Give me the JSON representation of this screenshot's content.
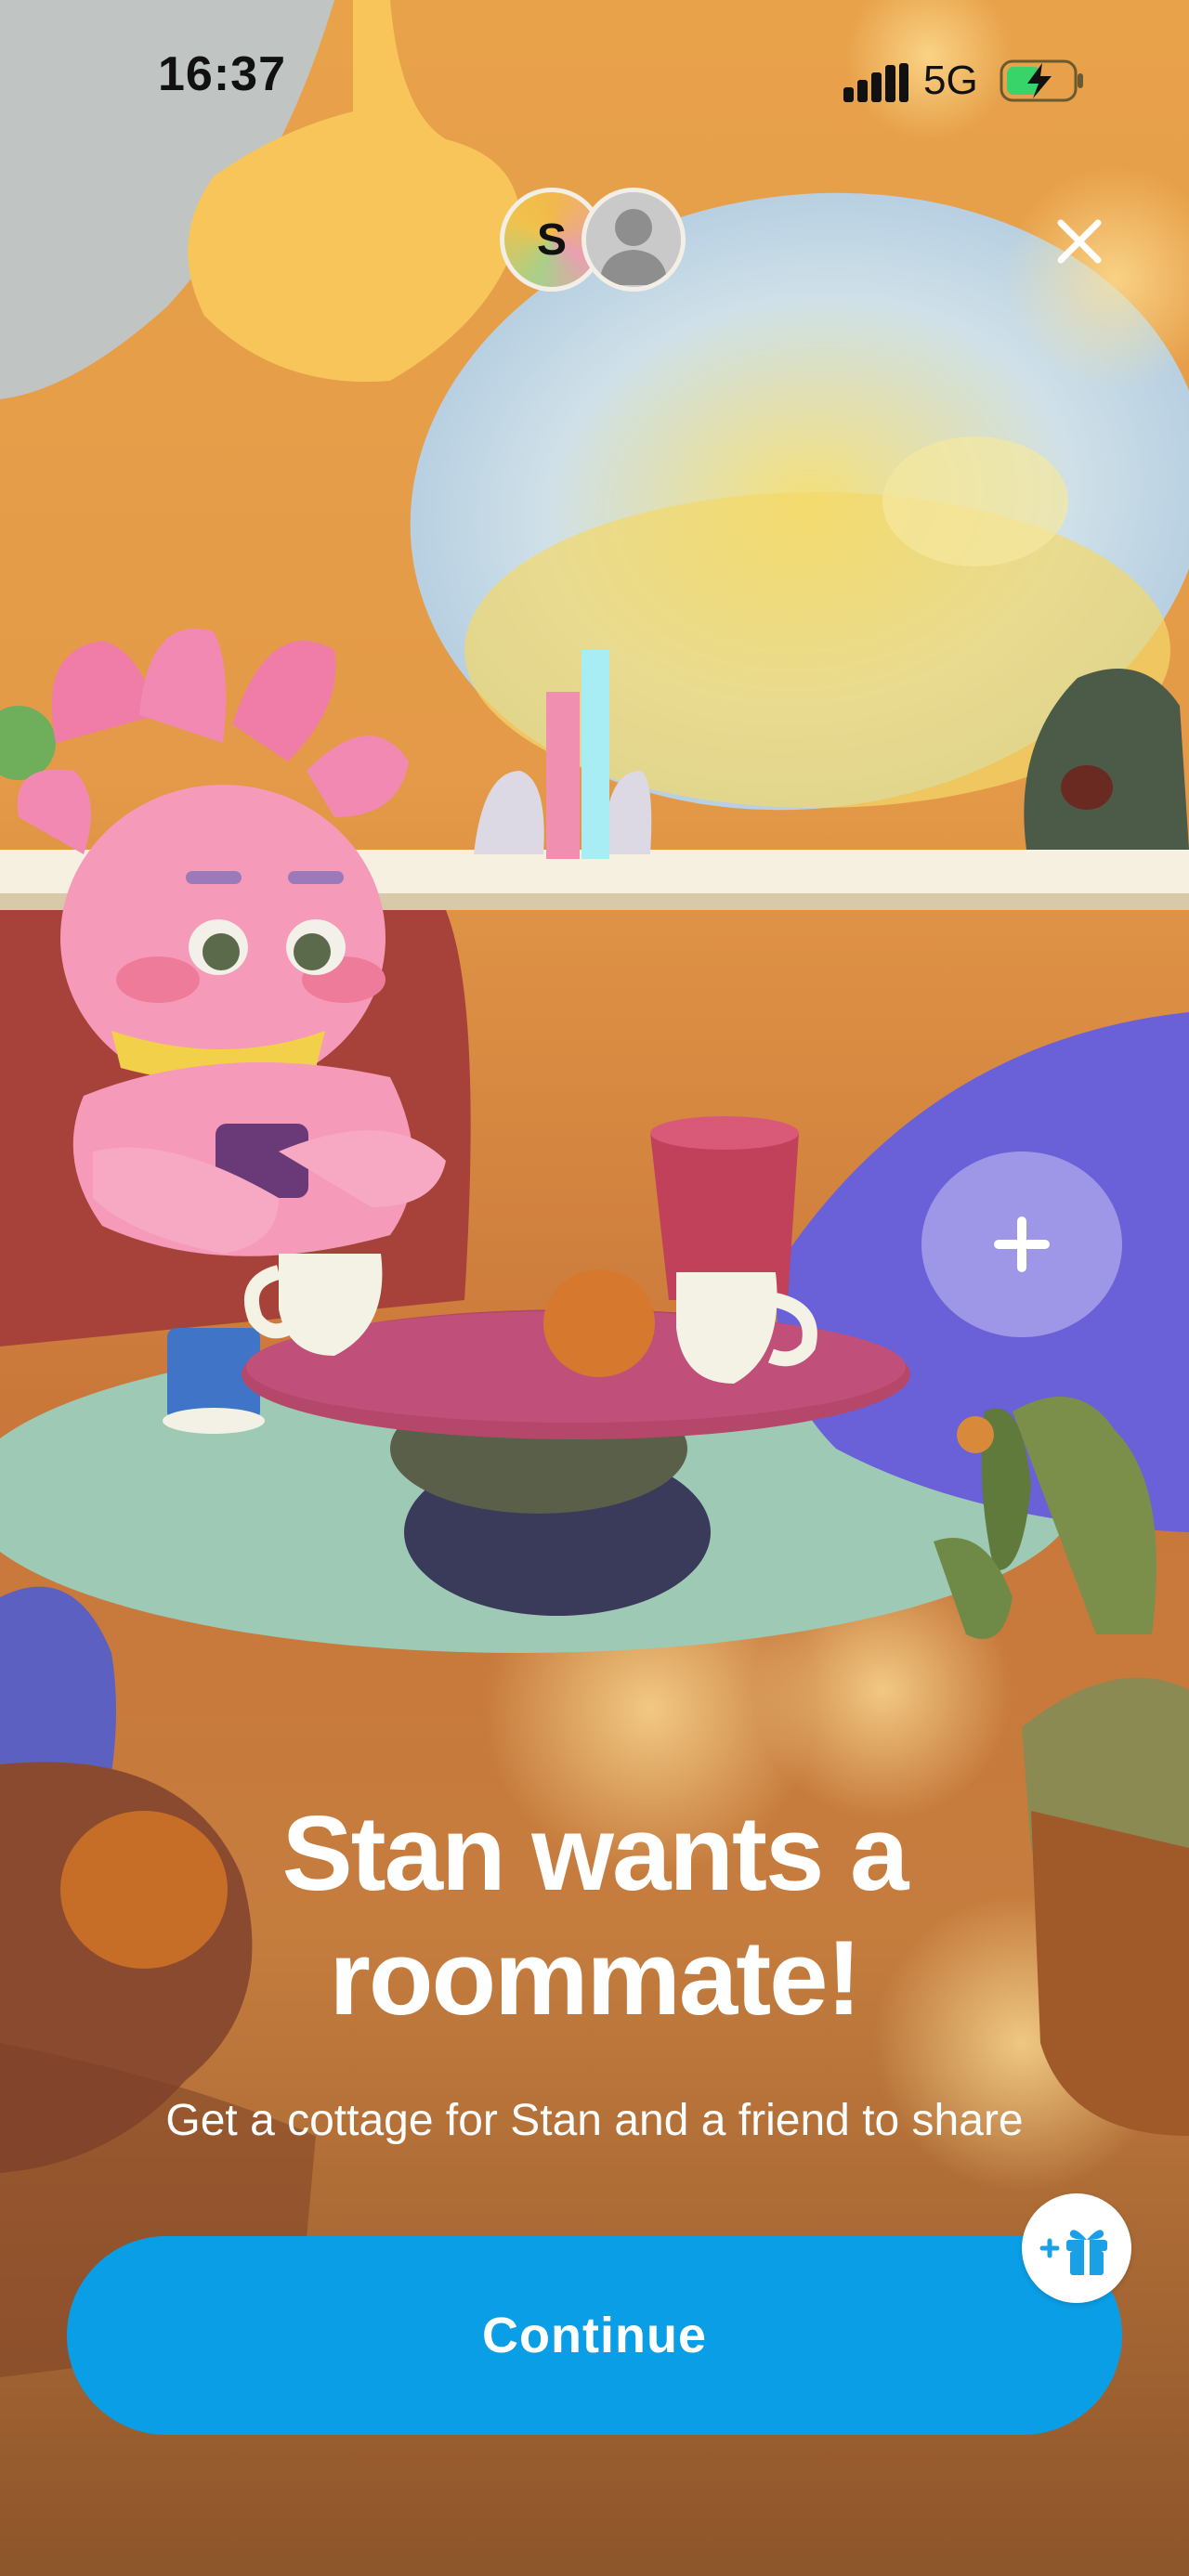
{
  "status_bar": {
    "time": "16:37",
    "network": "5G",
    "icons": [
      "cellular-signal-icon",
      "battery-charging-icon"
    ]
  },
  "header": {
    "avatar_initial": "S",
    "icons": [
      "user-silhouette-icon",
      "close-icon"
    ]
  },
  "scene": {
    "icons": [
      "plus-icon"
    ]
  },
  "main": {
    "headline_line1": "Stan wants a",
    "headline_line2": "roommate!",
    "subtitle": "Get a cottage for Stan and a friend to share"
  },
  "footer": {
    "continue_label": "Continue",
    "gift_icon": "gift-plus-icon"
  },
  "colors": {
    "primary_button": "#0a9ee6",
    "headline_text": "#ffffff",
    "background_warm": "#e49a48"
  }
}
